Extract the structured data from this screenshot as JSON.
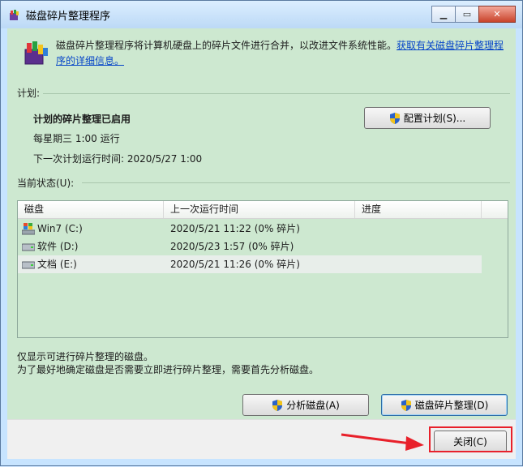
{
  "window": {
    "title": "磁盘碎片整理程序",
    "min_icon": "minimize-icon",
    "max_icon": "maximize-icon",
    "close_icon": "close-icon"
  },
  "intro": {
    "text": "磁盘碎片整理程序将计算机硬盘上的碎片文件进行合并，以改进文件系统性能。",
    "link": "获取有关磁盘碎片整理程序的详细信息。"
  },
  "schedule": {
    "label": "计划:",
    "status": "计划的碎片整理已启用",
    "frequency": "每星期三  1:00 运行",
    "next_run": "下一次计划运行时间: 2020/5/27 1:00",
    "configure_button": "配置计划(S)..."
  },
  "current_status": {
    "label": "当前状态(U):",
    "columns": [
      "磁盘",
      "上一次运行时间",
      "进度"
    ],
    "rows": [
      {
        "disk": "Win7 (C:)",
        "last_run": "2020/5/21 11:22 (0% 碎片)",
        "progress": "",
        "icon": "windows-drive-icon"
      },
      {
        "disk": "软件 (D:)",
        "last_run": "2020/5/23 1:57 (0% 碎片)",
        "progress": "",
        "icon": "drive-icon"
      },
      {
        "disk": "文档 (E:)",
        "last_run": "2020/5/21 11:26 (0% 碎片)",
        "progress": "",
        "icon": "drive-icon"
      }
    ]
  },
  "notes": {
    "line1": "仅显示可进行碎片整理的磁盘。",
    "line2": "为了最好地确定磁盘是否需要立即进行碎片整理，需要首先分析磁盘。"
  },
  "actions": {
    "analyze_button": "分析磁盘(A)",
    "defrag_button": "磁盘碎片整理(D)",
    "close_button": "关闭(C)"
  },
  "colors": {
    "client_bg": "#cde8d0",
    "annotation": "#e8202a",
    "link": "#0645c8"
  }
}
